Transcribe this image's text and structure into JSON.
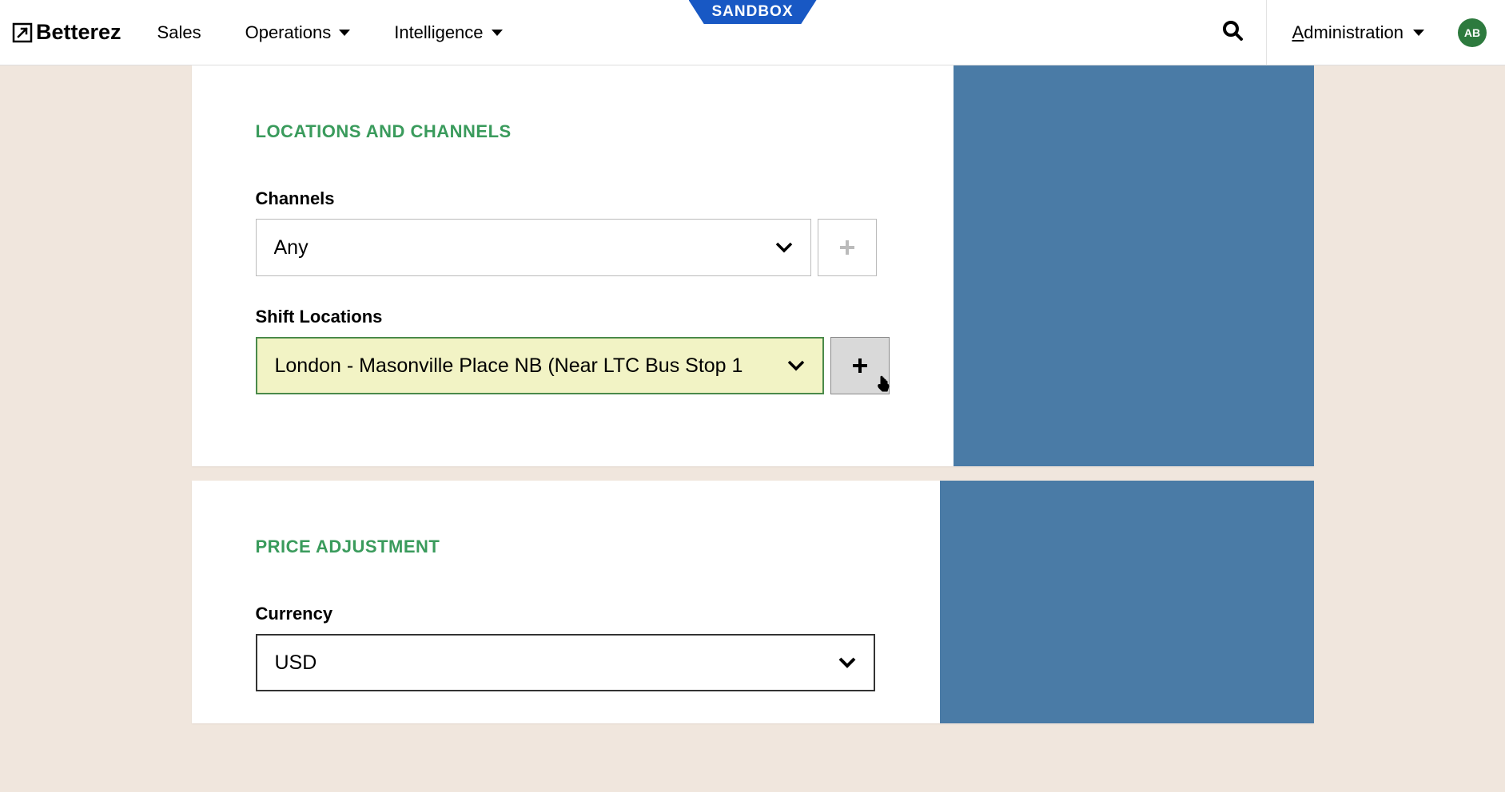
{
  "header": {
    "brand": "Betterez",
    "sandbox_label": "SANDBOX",
    "nav": {
      "sales": "Sales",
      "operations": "Operations",
      "intelligence": "Intelligence"
    },
    "admin_label": "Administration",
    "avatar_initials": "AB"
  },
  "section1": {
    "title": "LOCATIONS AND CHANNELS",
    "channels_label": "Channels",
    "channels_value": "Any",
    "shift_locations_label": "Shift Locations",
    "shift_locations_value": "London - Masonville Place NB (Near LTC Bus Stop 1"
  },
  "section2": {
    "title": "PRICE ADJUSTMENT",
    "currency_label": "Currency",
    "currency_value": "USD"
  }
}
